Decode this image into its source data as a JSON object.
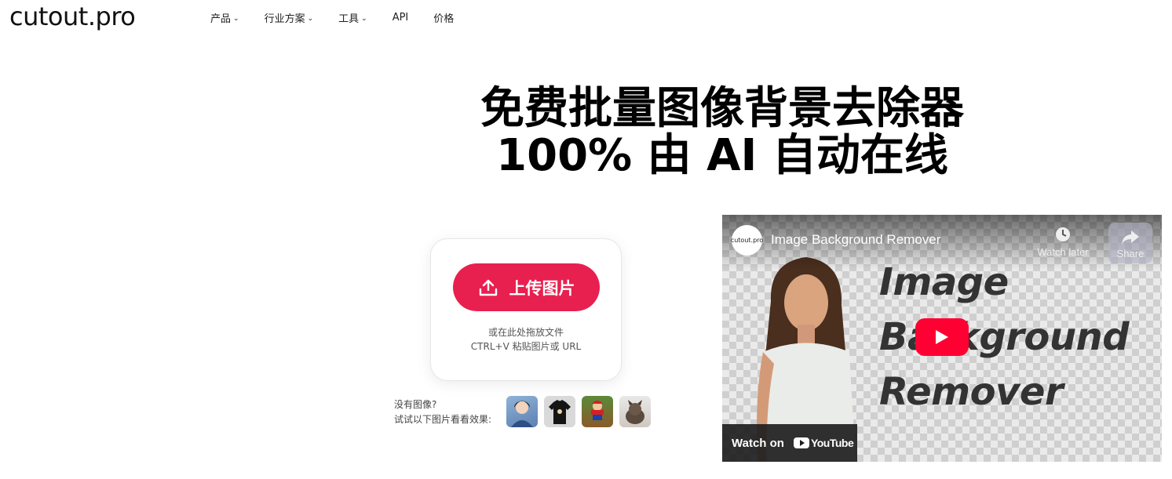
{
  "header": {
    "logo": "cutout.pro",
    "nav": [
      {
        "label": "产品",
        "has_dropdown": true
      },
      {
        "label": "行业方案",
        "has_dropdown": true
      },
      {
        "label": "工具",
        "has_dropdown": true
      },
      {
        "label": "API",
        "has_dropdown": false
      },
      {
        "label": "价格",
        "has_dropdown": false
      }
    ]
  },
  "hero": {
    "title_line1": "免费批量图像背景去除器",
    "title_line2": "100% 由 AI 自动在线"
  },
  "upload": {
    "button_label": "上传图片",
    "button_icon": "upload-icon",
    "hint_line1": "或在此处拖放文件",
    "hint_line2": "CTRL+V 粘贴图片或 URL",
    "accent_color": "#e8204f"
  },
  "samples": {
    "prompt_line1": "没有图像?",
    "prompt_line2": "试试以下图片看看效果:",
    "thumbnails": [
      "girl-portrait",
      "black-tshirt",
      "toy-figure",
      "puppy"
    ]
  },
  "video": {
    "channel": "cutout.pro",
    "title": "Image Background Remover",
    "watch_later": "Watch later",
    "share": "Share",
    "thumb_text_1": "Image",
    "thumb_text_2": "Background",
    "thumb_text_3": "Remover",
    "watch_on": "Watch on",
    "youtube": "YouTube",
    "play_color": "#ff0033"
  }
}
